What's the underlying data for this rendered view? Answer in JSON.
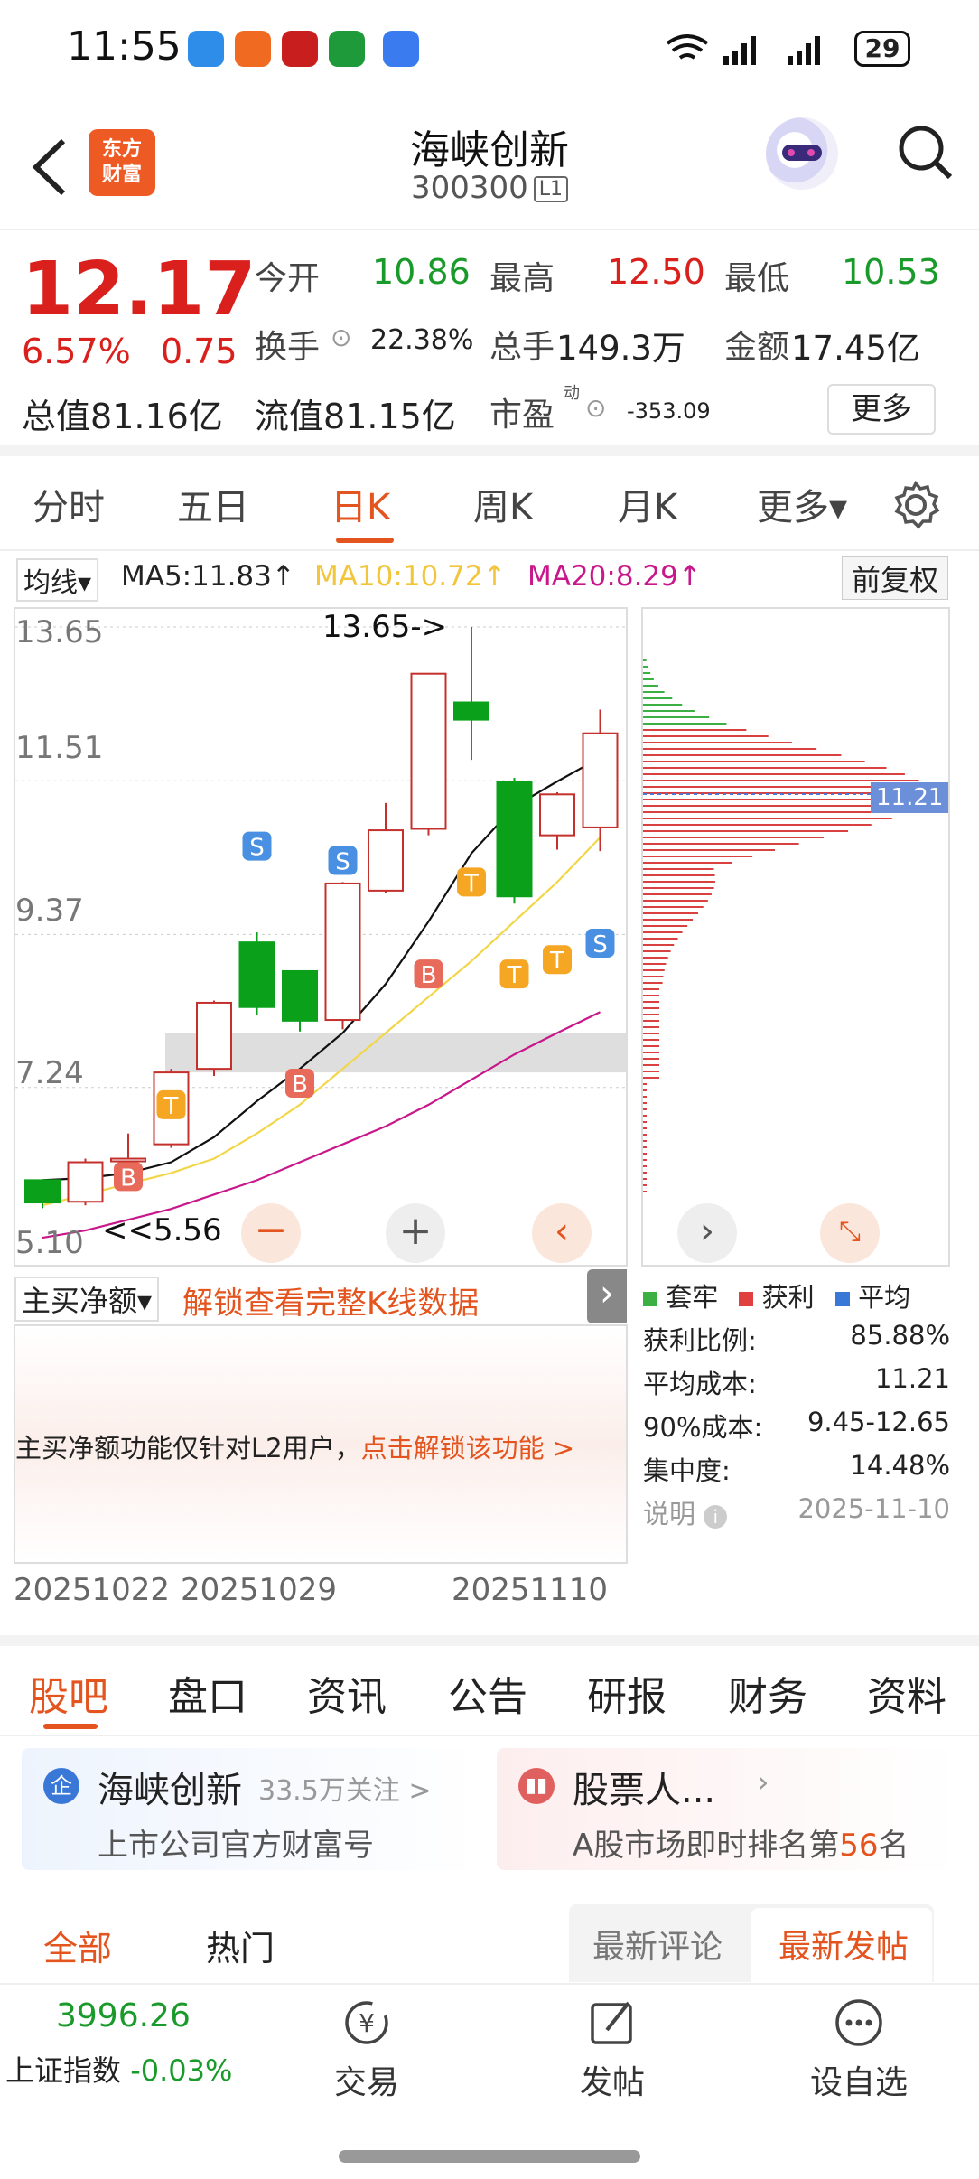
{
  "status": {
    "time": "11:55",
    "battery": "29"
  },
  "header": {
    "title": "海峡创新",
    "code": "300300",
    "level": "L1",
    "logo_line1": "东方",
    "logo_line2": "财富"
  },
  "quote": {
    "price": "12.17",
    "change_pct": "6.57%",
    "change": "0.75",
    "open_label": "今开",
    "open": "10.86",
    "high_label": "最高",
    "high": "12.50",
    "low_label": "最低",
    "low": "10.53",
    "turnover_label": "换手",
    "turnover": "22.38%",
    "volume_label": "总手",
    "volume": "149.3万",
    "amount_label": "金额",
    "amount": "17.45亿",
    "mcap_label": "总值",
    "mcap": "81.16亿",
    "float_label": "流值",
    "float": "81.15亿",
    "pe_label": "市盈",
    "pe_sup": "动",
    "pe": "-353.09",
    "more": "更多"
  },
  "tabs": [
    "分时",
    "五日",
    "日K",
    "周K",
    "月K",
    "更多▾"
  ],
  "ma": {
    "selector": "均线▾",
    "ma5": "MA5:11.83↑",
    "ma10": "MA10:10.72↑",
    "ma20": "MA20:8.29↑",
    "adjust": "前复权"
  },
  "chart": {
    "y_labels": [
      "13.65",
      "11.51",
      "9.37",
      "7.24",
      "5.10"
    ],
    "max_note": "13.65->",
    "min_note": "<<5.56",
    "avg_cost_tag": "11.21"
  },
  "chart_data": {
    "type": "candlestick",
    "dates_shown": [
      "20251022",
      "20251029",
      "20251110"
    ],
    "candles": [
      {
        "open": 5.95,
        "close": 5.64,
        "high": 5.95,
        "low": 5.56
      },
      {
        "open": 5.65,
        "close": 6.2,
        "high": 6.25,
        "low": 5.6
      },
      {
        "open": 6.25,
        "close": 6.25,
        "high": 6.6,
        "low": 6.2
      },
      {
        "open": 6.45,
        "close": 7.45,
        "high": 7.5,
        "low": 6.4
      },
      {
        "open": 7.5,
        "close": 8.42,
        "high": 8.45,
        "low": 7.4
      },
      {
        "open": 9.26,
        "close": 8.36,
        "high": 9.4,
        "low": 8.25
      },
      {
        "open": 8.86,
        "close": 8.17,
        "high": 8.86,
        "low": 8.02
      },
      {
        "open": 8.18,
        "close": 10.08,
        "high": 10.1,
        "low": 8.05
      },
      {
        "open": 9.98,
        "close": 10.82,
        "high": 11.2,
        "low": 9.95
      },
      {
        "open": 10.84,
        "close": 13.0,
        "high": 13.0,
        "low": 10.75
      },
      {
        "open": 12.6,
        "close": 12.36,
        "high": 13.65,
        "low": 11.8
      },
      {
        "open": 11.5,
        "close": 9.9,
        "high": 11.55,
        "low": 9.8
      },
      {
        "open": 10.75,
        "close": 11.32,
        "high": 11.35,
        "low": 10.55
      },
      {
        "open": 10.86,
        "close": 12.17,
        "high": 12.5,
        "low": 10.53
      }
    ],
    "ma5": [
      5.95,
      5.98,
      6.05,
      6.2,
      6.55,
      7.05,
      7.5,
      8.0,
      8.68,
      9.55,
      10.5,
      11.15,
      11.5,
      11.83
    ],
    "ma10": [
      5.6,
      5.75,
      5.9,
      6.05,
      6.25,
      6.6,
      7.0,
      7.5,
      8.0,
      8.5,
      9.0,
      9.55,
      10.1,
      10.72
    ],
    "ma20": [
      5.15,
      5.25,
      5.4,
      5.55,
      5.75,
      5.95,
      6.2,
      6.45,
      6.7,
      7.0,
      7.35,
      7.7,
      8.0,
      8.29
    ]
  },
  "volume_profile": {
    "legend": [
      {
        "label": "套牢",
        "color": "#3cb043"
      },
      {
        "label": "获利",
        "color": "#e04040"
      },
      {
        "label": "平均",
        "color": "#3a78d8"
      }
    ],
    "stats": [
      {
        "label": "获利比例:",
        "value": "85.88%"
      },
      {
        "label": "平均成本:",
        "value": "11.21"
      },
      {
        "label": "90%成本:",
        "value": "9.45-12.65"
      },
      {
        "label": "集中度:",
        "value": "14.48%"
      }
    ],
    "note_label": "说明",
    "note_date": "2025-11-10"
  },
  "sub": {
    "selector": "主买净额▾",
    "unlock": "解锁查看完整K线数据",
    "msg": "主买净额功能仅针对L2用户，",
    "msg_link": "点击解锁该功能 >"
  },
  "nav": [
    "股吧",
    "盘口",
    "资讯",
    "公告",
    "研报",
    "财务",
    "资料"
  ],
  "cards": {
    "left_title": "海峡创新",
    "left_follow": "33.5万关注 >",
    "left_sub": "上市公司官方财富号",
    "right_title": "股票人...",
    "right_sub_a": "A股市场即时排名第",
    "right_rank": "56",
    "right_sub_b": "名"
  },
  "filter": {
    "all": "全部",
    "hot": "热门",
    "latest_comment": "最新评论",
    "latest_post": "最新发帖"
  },
  "bottom": {
    "index_value": "3996.26",
    "index_name": "上证指数",
    "index_change": "-0.03%",
    "trade": "交易",
    "post": "发帖",
    "watch": "设自选"
  }
}
